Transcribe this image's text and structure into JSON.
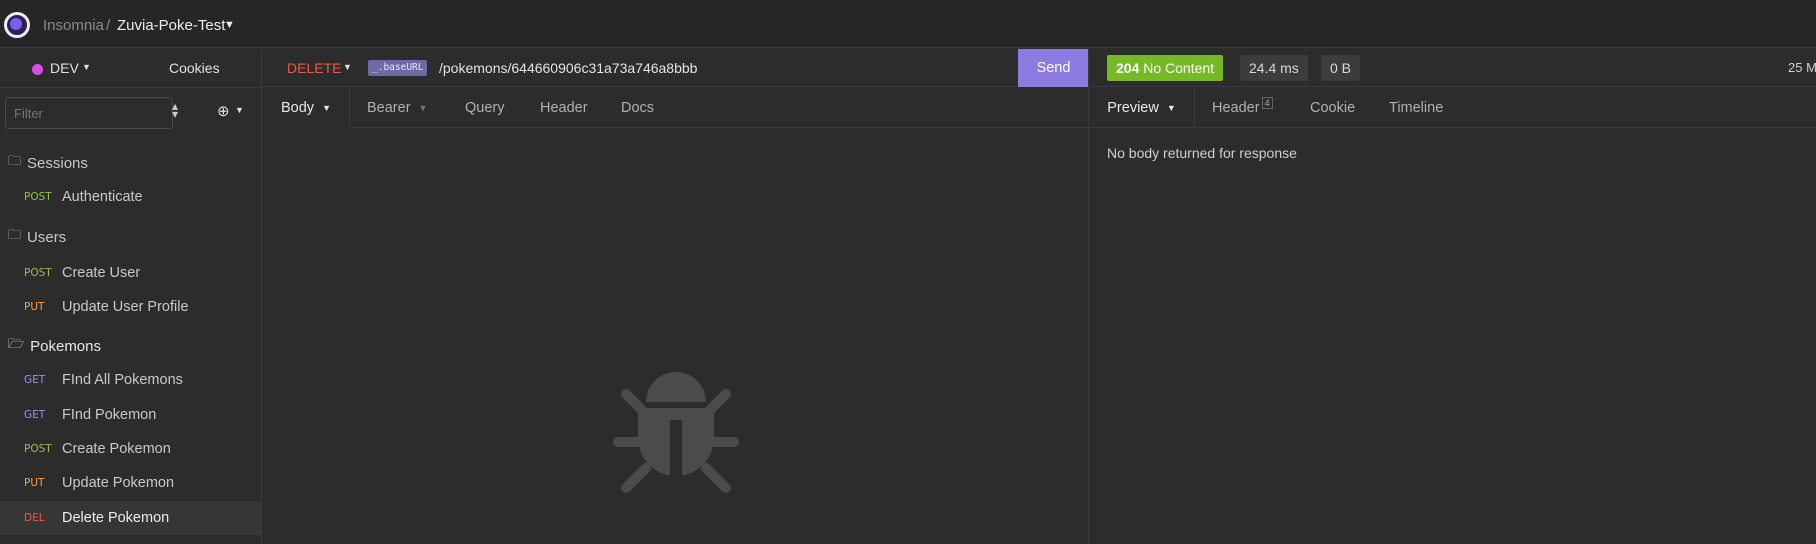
{
  "titlebar": {
    "workspace": "Insomnia",
    "separator": "/",
    "project": "Zuvia-Poke-Test"
  },
  "sidebar": {
    "environment": "DEV",
    "cookies": "Cookies",
    "filter_placeholder": "Filter",
    "groups": [
      {
        "name": "Sessions",
        "open": false,
        "requests": [
          {
            "method": "POST",
            "label": "Authenticate"
          }
        ]
      },
      {
        "name": "Users",
        "open": false,
        "requests": [
          {
            "method": "POST",
            "label": "Create User"
          },
          {
            "method": "PUT",
            "label": "Update User Profile"
          }
        ]
      },
      {
        "name": "Pokemons",
        "open": true,
        "requests": [
          {
            "method": "GET",
            "label": "FInd All Pokemons"
          },
          {
            "method": "GET",
            "label": "FInd Pokemon"
          },
          {
            "method": "POST",
            "label": "Create Pokemon"
          },
          {
            "method": "PUT",
            "label": "Update Pokemon"
          },
          {
            "method": "DEL",
            "label": "Delete Pokemon"
          }
        ]
      }
    ]
  },
  "request": {
    "method": "DELETE",
    "base_url_tag": "_.baseURL",
    "path": "/pokemons/644660906c31a73a746a8bbb",
    "send": "Send",
    "tabs": {
      "body": "Body",
      "auth": "Bearer",
      "query": "Query",
      "header": "Header",
      "docs": "Docs"
    }
  },
  "response": {
    "status_code": "204",
    "status_text": "No Content",
    "time": "24.4 ms",
    "size": "0 B",
    "truncated_right": "25 M",
    "tabs": {
      "preview": "Preview",
      "header": "Header",
      "header_count": "4",
      "cookie": "Cookie",
      "timeline": "Timeline"
    },
    "message": "No body returned for response"
  },
  "colors": {
    "accent": "#8d7ae0",
    "status_ok": "#75ba24",
    "post": "#8bc34a",
    "put": "#ff9f3d",
    "get": "#a58af5",
    "delete": "#f0593e"
  }
}
